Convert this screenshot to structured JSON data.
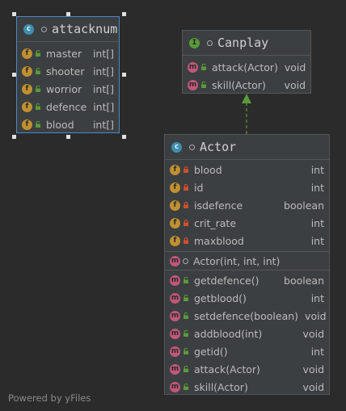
{
  "footer": "Powered by yFiles",
  "attacknum": {
    "title": "attacknum",
    "fields": [
      {
        "name": "master",
        "type": "int[]"
      },
      {
        "name": "shooter",
        "type": "int[]"
      },
      {
        "name": "worrior",
        "type": "int[]"
      },
      {
        "name": "defence",
        "type": "int[]"
      },
      {
        "name": "blood",
        "type": "int[]"
      }
    ]
  },
  "canplay": {
    "title": "Canplay",
    "methods": [
      {
        "name": "attack(Actor)",
        "type": "void"
      },
      {
        "name": "skill(Actor)",
        "type": "void"
      }
    ]
  },
  "actor": {
    "title": "Actor",
    "fields": [
      {
        "name": "blood",
        "type": "int"
      },
      {
        "name": "id",
        "type": "int"
      },
      {
        "name": "isdefence",
        "type": "boolean"
      },
      {
        "name": "crit_rate",
        "type": "int"
      },
      {
        "name": "maxblood",
        "type": "int"
      }
    ],
    "constructor": {
      "name": "Actor(int, int, int)",
      "type": ""
    },
    "methods": [
      {
        "name": "getdefence()",
        "type": "boolean"
      },
      {
        "name": "getblood()",
        "type": "int"
      },
      {
        "name": "setdefence(boolean)",
        "type": "void"
      },
      {
        "name": "addblood(int)",
        "type": "void"
      },
      {
        "name": "getid()",
        "type": "int"
      },
      {
        "name": "attack(Actor)",
        "type": "void"
      },
      {
        "name": "skill(Actor)",
        "type": "void"
      }
    ]
  },
  "colors": {
    "public": "#5a9a3a",
    "private": "#d0502e",
    "arrow": "#5a9a3a"
  }
}
